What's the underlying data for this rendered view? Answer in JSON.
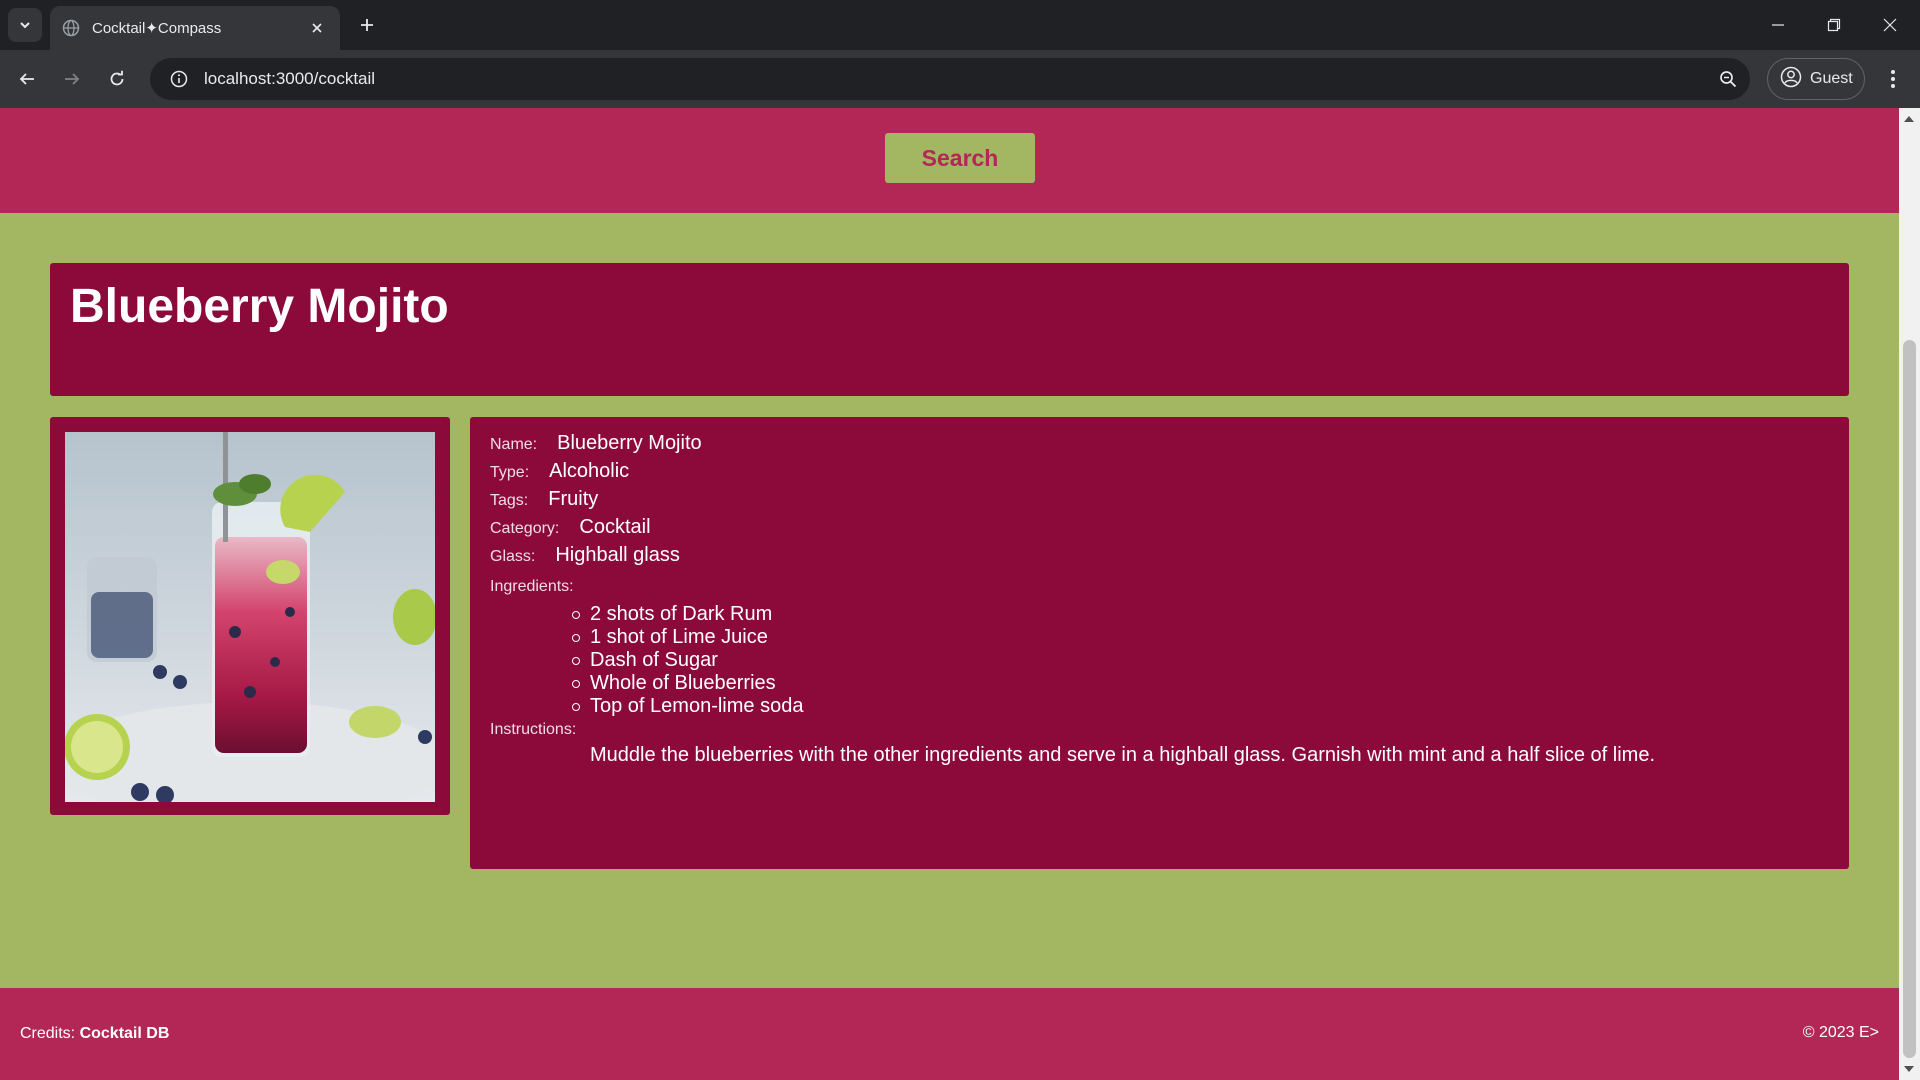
{
  "browser": {
    "tab_title": "Cocktail✦Compass",
    "url": "localhost:3000/cocktail",
    "profile_label": "Guest"
  },
  "page": {
    "search_button": "Search",
    "title": "Blueberry Mojito",
    "details": {
      "name_label": "Name:",
      "name_value": "Blueberry Mojito",
      "type_label": "Type:",
      "type_value": "Alcoholic",
      "tags_label": "Tags:",
      "tags_value": "Fruity",
      "category_label": "Category:",
      "category_value": "Cocktail",
      "glass_label": "Glass:",
      "glass_value": "Highball glass",
      "ingredients_label": "Ingredients:",
      "ingredients": [
        "2 shots of Dark Rum",
        "1 shot of Lime Juice",
        "Dash of Sugar",
        "Whole of Blueberries",
        "Top of Lemon-lime soda"
      ],
      "instructions_label": "Instructions:",
      "instructions": "Muddle the blueberries with the other ingredients and serve in a highball glass. Garnish with mint and a half slice of lime."
    },
    "footer": {
      "credits_prefix": "Credits: ",
      "credits_source": "Cocktail DB",
      "copyright": "© 2023 E>"
    }
  },
  "colors": {
    "header_band": "#b22756",
    "page_background": "#a3b763",
    "card": "#8b0a3a"
  },
  "icons": [
    "tab-search-icon",
    "globe-icon",
    "close-icon",
    "plus-icon",
    "minimize-icon",
    "restore-icon",
    "window-close-icon",
    "back-arrow-icon",
    "forward-arrow-icon",
    "reload-icon",
    "site-info-icon",
    "zoom-icon",
    "profile-icon",
    "kebab-menu-icon"
  ]
}
